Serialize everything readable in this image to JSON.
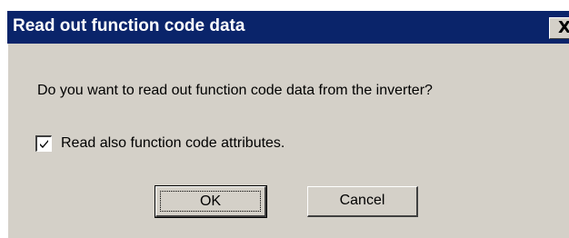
{
  "dialog": {
    "title": "Read out function code data",
    "close_label": "X",
    "message": "Do you want to read out function code data from the inverter?",
    "checkbox": {
      "label": "Read also function code attributes.",
      "checked": true
    },
    "buttons": {
      "ok": "OK",
      "cancel": "Cancel"
    }
  },
  "colors": {
    "title_bar": "#0a246a",
    "face": "#d4d0c8"
  }
}
